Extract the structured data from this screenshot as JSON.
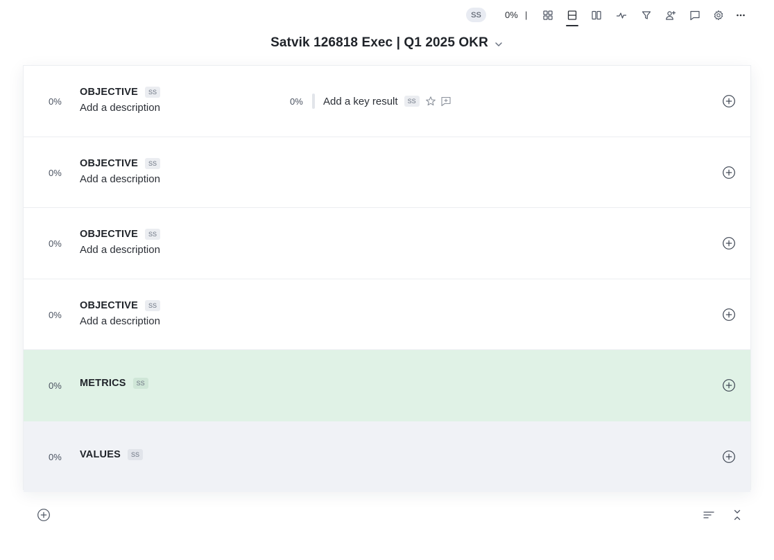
{
  "toolbar": {
    "avatar_initials": "SS",
    "progress": "0%",
    "separator": "|",
    "icons": [
      "grid-view-icon",
      "list-view-icon",
      "columns-view-icon",
      "activity-icon",
      "filter-icon",
      "add-user-icon",
      "comment-icon",
      "settings-icon",
      "more-icon"
    ],
    "active_view": "list-view-icon"
  },
  "board": {
    "title": "Satvik 126818 Exec | Q1 2025 OKR",
    "rows": [
      {
        "progress": "0%",
        "label": "OBJECTIVE",
        "owner": "SS",
        "description": "Add a description"
      },
      {
        "progress": "0%",
        "label": "OBJECTIVE",
        "owner": "SS",
        "description": "Add a description"
      },
      {
        "progress": "0%",
        "label": "OBJECTIVE",
        "owner": "SS",
        "description": "Add a description"
      },
      {
        "progress": "0%",
        "label": "OBJECTIVE",
        "owner": "SS",
        "description": "Add a description"
      },
      {
        "progress": "0%",
        "label": "METRICS",
        "owner": "SS"
      },
      {
        "progress": "0%",
        "label": "VALUES",
        "owner": "SS"
      }
    ],
    "key_result": {
      "progress": "0%",
      "placeholder": "Add a key result",
      "owner": "SS"
    }
  },
  "colors": {
    "metrics_row": "#e0f2e6",
    "values_row": "#f0f2f6",
    "text_primary": "#1f2329",
    "text_secondary": "#4a5260"
  }
}
